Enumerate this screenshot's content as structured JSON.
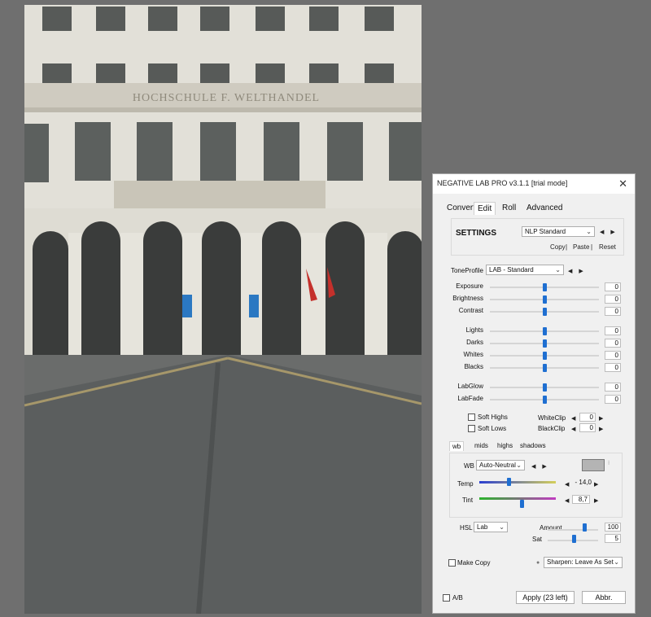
{
  "window": {
    "title": "NEGATIVE LAB PRO v3.1.1 [trial mode]",
    "close": "✕"
  },
  "tabs": [
    "Convert",
    "Edit",
    "Roll",
    "Advanced"
  ],
  "settings": {
    "label": "SETTINGS",
    "preset": "NLP Standard",
    "copy": "Copy",
    "paste": "Paste",
    "reset": "Reset",
    "sep": "|"
  },
  "tone_profile": {
    "label": "ToneProfile",
    "value": "LAB - Standard"
  },
  "sliders_a": [
    {
      "label": "Exposure",
      "value": "0",
      "level": 0.5
    },
    {
      "label": "Brightness",
      "value": "0",
      "level": 0.5
    },
    {
      "label": "Contrast",
      "value": "0",
      "level": 0.5
    }
  ],
  "sliders_b": [
    {
      "label": "Lights",
      "value": "0",
      "level": 0.5
    },
    {
      "label": "Darks",
      "value": "0",
      "level": 0.5
    },
    {
      "label": "Whites",
      "value": "0",
      "level": 0.5
    },
    {
      "label": "Blacks",
      "value": "0",
      "level": 0.5
    }
  ],
  "sliders_c": [
    {
      "label": "LabGlow",
      "value": "0",
      "level": 0.5
    },
    {
      "label": "LabFade",
      "value": "0",
      "level": 0.5
    }
  ],
  "soft": {
    "highs": "Soft Highs",
    "lows": "Soft Lows"
  },
  "clip": {
    "white_label": "WhiteClip",
    "white_value": "0",
    "black_label": "BlackClip",
    "black_value": "0"
  },
  "color_tabs": [
    "wb",
    "mids",
    "highs",
    "shadows"
  ],
  "wb": {
    "label": "WB",
    "value": "Auto-Neutral",
    "temp_label": "Temp",
    "temp_value": "- 14,0",
    "temp_level": 0.38,
    "tint_label": "Tint",
    "tint_value": "8,7",
    "tint_level": 0.55,
    "swatch": "#b4b4b4"
  },
  "hsl": {
    "label": "HSL",
    "value": "Lab",
    "amount_label": "Amount",
    "amount_value": "100",
    "amount_level": 1.0,
    "sat_label": "Sat",
    "sat_value": "5",
    "sat_level": 0.52
  },
  "make_copy": "Make Copy",
  "sharpen": "Sharpen: Leave As Set",
  "ab": "A/B",
  "apply": "Apply (23 left)",
  "abbr": "Abbr.",
  "building_sign": "HOCHSCHULE F. WELTHANDEL",
  "colors": {
    "accent": "#1f6fd1",
    "panel_bg": "#f0f0f0",
    "canvas_bg": "#6f6f6f"
  }
}
